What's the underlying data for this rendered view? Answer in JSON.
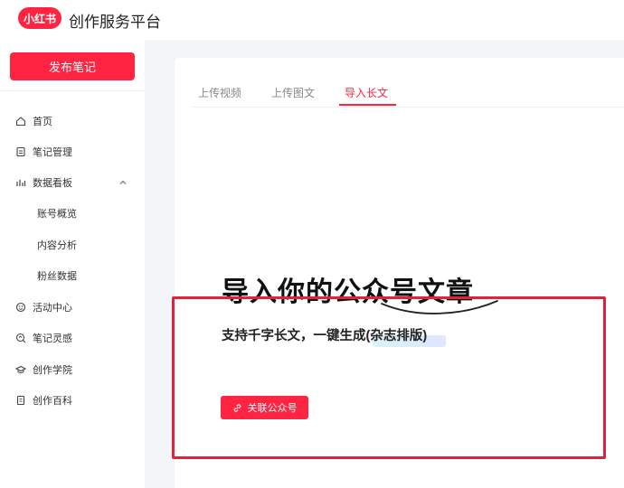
{
  "header": {
    "logo_text": "小红书",
    "title": "创作服务平台",
    "brand_color": "#ff2442"
  },
  "sidebar": {
    "publish_label": "发布笔记",
    "items": [
      {
        "label": "首页",
        "icon": "home-icon"
      },
      {
        "label": "笔记管理",
        "icon": "note-icon"
      },
      {
        "label": "数据看板",
        "icon": "bar-chart-icon",
        "expanded": true
      },
      {
        "label": "账号概览",
        "sub": true
      },
      {
        "label": "内容分析",
        "sub": true
      },
      {
        "label": "粉丝数据",
        "sub": true
      },
      {
        "label": "活动中心",
        "icon": "activity-icon"
      },
      {
        "label": "笔记灵感",
        "icon": "inspiration-icon"
      },
      {
        "label": "创作学院",
        "icon": "academy-icon"
      },
      {
        "label": "创作百科",
        "icon": "encyclopedia-icon"
      }
    ]
  },
  "main": {
    "tabs": [
      {
        "label": "上传视频",
        "active": false
      },
      {
        "label": "上传图文",
        "active": false
      },
      {
        "label": "导入长文",
        "active": true
      }
    ],
    "hero_title": "导入你的公众号文章",
    "subtitle": "支持千字长文，一键生成(杂志排版)",
    "link_button_label": "关联公众号",
    "annotation_color": "#e0233c"
  }
}
